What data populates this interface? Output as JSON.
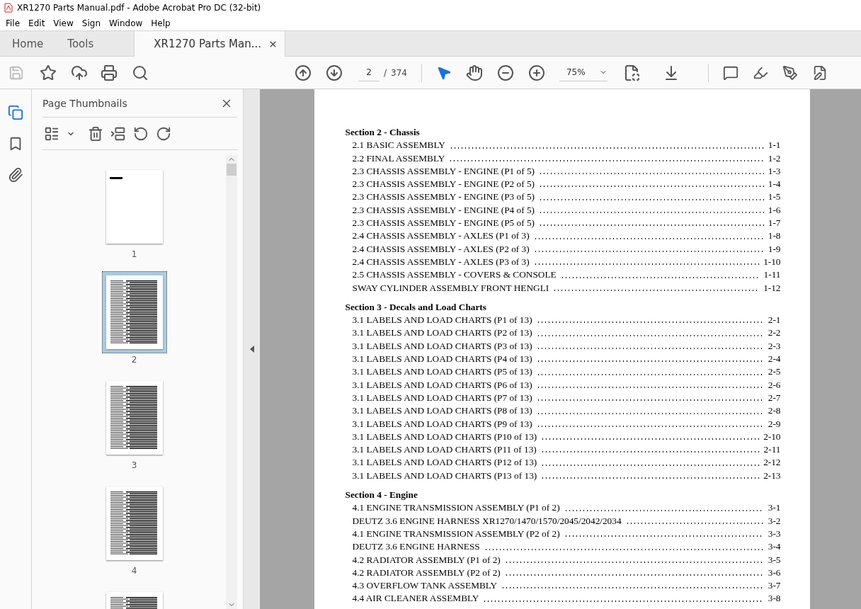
{
  "window": {
    "title": "XR1270 Parts Manual.pdf - Adobe Acrobat Pro DC (32-bit)"
  },
  "menu": [
    "File",
    "Edit",
    "View",
    "Sign",
    "Window",
    "Help"
  ],
  "tabs": [
    {
      "label": "Home",
      "selected": false,
      "closable": false
    },
    {
      "label": "Tools",
      "selected": false,
      "closable": false
    },
    {
      "label": "XR1270 Parts Man...",
      "selected": true,
      "closable": true
    }
  ],
  "toolbar": {
    "page": "2",
    "separator": "/",
    "total": "374",
    "zoom": "75%"
  },
  "sidebar": {
    "title": "Page Thumbnails",
    "thumbnails": [
      {
        "label": "1",
        "selected": false,
        "kind": "title-page"
      },
      {
        "label": "2",
        "selected": true,
        "kind": "text-page"
      },
      {
        "label": "3",
        "selected": false,
        "kind": "text-page"
      },
      {
        "label": "4",
        "selected": false,
        "kind": "text-page"
      },
      {
        "selected": false,
        "kind": "text-page"
      }
    ]
  },
  "document": {
    "sections": [
      {
        "title": "Section 2 - Chassis",
        "entries": [
          {
            "title": "2.1 BASIC ASSEMBLY",
            "page": "1-1"
          },
          {
            "title": "2.2 FINAL ASSEMBLY",
            "page": "1-2"
          },
          {
            "title": "2.3 CHASSIS ASSEMBLY - ENGINE (P1 of 5)",
            "page": "1-3"
          },
          {
            "title": "2.3 CHASSIS ASSEMBLY - ENGINE (P2 of 5)",
            "page": "1-4"
          },
          {
            "title": "2.3 CHASSIS ASSEMBLY - ENGINE (P3 of 5)",
            "page": "1-5"
          },
          {
            "title": "2.3 CHASSIS ASSEMBLY - ENGINE (P4 of 5)",
            "page": "1-6"
          },
          {
            "title": "2.3 CHASSIS ASSEMBLY - ENGINE (P5 of 5)",
            "page": "1-7"
          },
          {
            "title": "2.4 CHASSIS ASSEMBLY - AXLES (P1 of 3)",
            "page": "1-8"
          },
          {
            "title": "2.4 CHASSIS ASSEMBLY - AXLES (P2 of 3)",
            "page": "1-9"
          },
          {
            "title": "2.4 CHASSIS ASSEMBLY - AXLES (P3 of 3)",
            "page": "1-10"
          },
          {
            "title": "2.5 CHASSIS ASSEMBLY - COVERS & CONSOLE",
            "page": "1-11"
          },
          {
            "title": "SWAY CYLINDER ASSEMBLY FRONT HENGLI",
            "page": "1-12"
          }
        ]
      },
      {
        "title": "Section 3 - Decals and Load Charts",
        "entries": [
          {
            "title": "3.1 LABELS AND LOAD CHARTS (P1 of 13)",
            "page": "2-1"
          },
          {
            "title": "3.1 LABELS AND LOAD CHARTS (P2 of 13)",
            "page": "2-2"
          },
          {
            "title": "3.1 LABELS AND LOAD CHARTS (P3 of 13)",
            "page": "2-3"
          },
          {
            "title": "3.1 LABELS AND LOAD CHARTS (P4 of 13)",
            "page": "2-4"
          },
          {
            "title": "3.1 LABELS AND LOAD CHARTS (P5 of 13)",
            "page": "2-5"
          },
          {
            "title": "3.1 LABELS AND LOAD CHARTS (P6 of 13)",
            "page": "2-6"
          },
          {
            "title": "3.1 LABELS AND LOAD CHARTS (P7 of 13)",
            "page": "2-7"
          },
          {
            "title": "3.1 LABELS AND LOAD CHARTS (P8 of 13)",
            "page": "2-8"
          },
          {
            "title": "3.1 LABELS AND LOAD CHARTS (P9 of 13)",
            "page": "2-9"
          },
          {
            "title": "3.1 LABELS AND LOAD CHARTS (P10 of 13)",
            "page": "2-10"
          },
          {
            "title": "3.1 LABELS AND LOAD CHARTS (P11 of 13)",
            "page": "2-11"
          },
          {
            "title": "3.1 LABELS AND LOAD CHARTS (P12 of 13)",
            "page": "2-12"
          },
          {
            "title": "3.1 LABELS AND LOAD CHARTS (P13 of 13)",
            "page": "2-13"
          }
        ]
      },
      {
        "title": "Section 4 - Engine",
        "entries": [
          {
            "title": "4.1 ENGINE TRANSMISSION ASSEMBLY (P1 of 2)",
            "page": "3-1"
          },
          {
            "title": "DEUTZ 3.6 ENGINE HARNESS XR1270/1470/1570/2045/2042/2034",
            "page": "3-2"
          },
          {
            "title": "4.1 ENGINE TRANSMISSION ASSEMBLY (P2 of 2)",
            "page": "3-3"
          },
          {
            "title": "DEUTZ 3.6 ENGINE HARNESS",
            "page": "3-4"
          },
          {
            "title": "4.2 RADIATOR ASSEMBLY (P1 of 2)",
            "page": "3-5"
          },
          {
            "title": "4.2 RADIATOR ASSEMBLY (P2 of 2)",
            "page": "3-6"
          },
          {
            "title": "4.3 OVERFLOW TANK ASSEMBLY",
            "page": "3-7"
          },
          {
            "title": "4.4 AIR CLEANER ASSEMBLY",
            "page": "3-8"
          }
        ]
      }
    ]
  }
}
